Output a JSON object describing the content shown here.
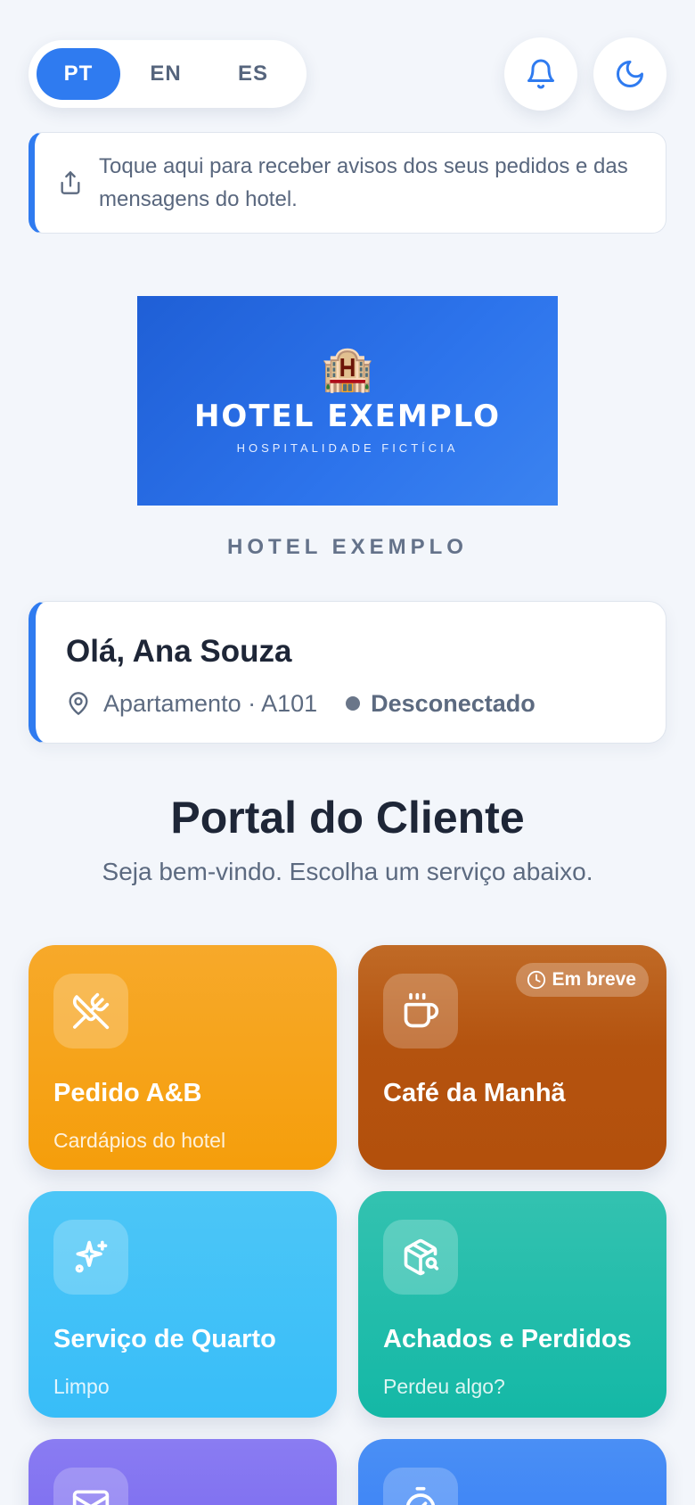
{
  "languages": [
    {
      "code": "PT",
      "active": true
    },
    {
      "code": "EN",
      "active": false
    },
    {
      "code": "ES",
      "active": false
    }
  ],
  "header": {
    "notifications_icon": "bell-icon",
    "theme_icon": "moon-icon"
  },
  "notice": {
    "icon": "share-upload-icon",
    "text": "Toque aqui para receber avisos dos seus pedidos e das mensagens do hotel."
  },
  "logo": {
    "title": "HOTEL EXEMPLO",
    "subtitle": "HOSPITALIDADE FICTÍCIA",
    "emoji": "🏨"
  },
  "hotel_name": "HOTEL EXEMPLO",
  "guest": {
    "greeting": "Olá, Ana Souza",
    "location": "Apartamento · A101",
    "status": "Desconectado"
  },
  "portal": {
    "title": "Portal do Cliente",
    "subtitle": "Seja bem-vindo. Escolha um serviço abaixo."
  },
  "services": [
    {
      "title": "Pedido A&B",
      "desc": "Cardápios do hotel",
      "icon": "utensils-icon",
      "color": "#f59e0b"
    },
    {
      "title": "Café da Manhã",
      "desc": "",
      "icon": "coffee-icon",
      "color": "#b4530f",
      "badge": "Em breve"
    },
    {
      "title": "Serviço de Quarto",
      "desc": "Limpo",
      "icon": "sparkles-icon",
      "color": "#38bdf8"
    },
    {
      "title": "Achados e Perdidos",
      "desc": "Perdeu algo?",
      "icon": "package-search-icon",
      "color": "#14b8a6"
    },
    {
      "title": "",
      "desc": "",
      "icon": "mail-icon",
      "color": "#7c6cf0"
    },
    {
      "title": "",
      "desc": "",
      "icon": "timer-icon",
      "color": "#3b82f6"
    }
  ]
}
